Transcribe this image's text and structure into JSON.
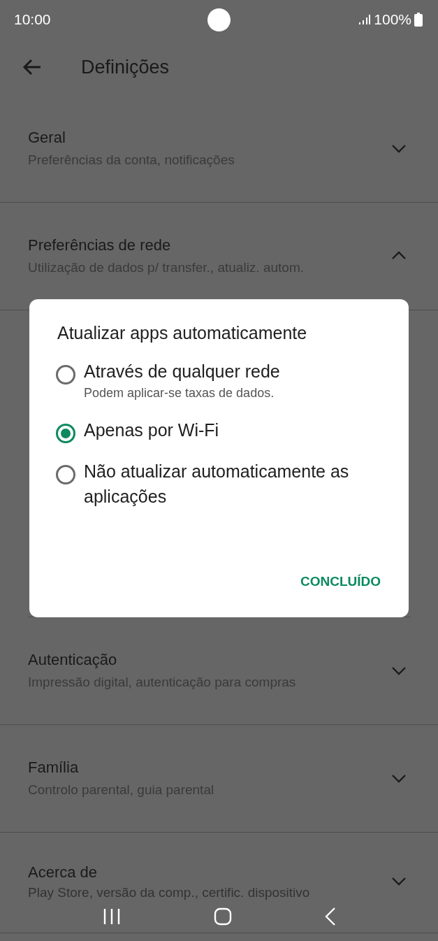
{
  "status_bar": {
    "time": "10:00",
    "battery": "100%"
  },
  "header": {
    "title": "Definições"
  },
  "sections": [
    {
      "title": "Geral",
      "subtitle": "Preferências da conta, notificações",
      "expanded": false
    },
    {
      "title": "Preferências de rede",
      "subtitle": "Utilização de dados p/ transfer., atualiz. autom.",
      "expanded": true
    },
    {
      "title": "Autenticação",
      "subtitle": "Impressão digital, autenticação para compras",
      "expanded": false
    },
    {
      "title": "Família",
      "subtitle": "Controlo parental, guia parental",
      "expanded": false
    },
    {
      "title": "Acerca de",
      "subtitle": "Play Store, versão da comp., certific. dispositivo",
      "expanded": false
    }
  ],
  "dialog": {
    "title": "Atualizar apps automaticamente",
    "options": [
      {
        "label": "Através de qualquer rede",
        "hint": "Podem aplicar-se taxas de dados.",
        "selected": false
      },
      {
        "label": "Apenas por Wi-Fi",
        "selected": true
      },
      {
        "label": "Não atualizar automaticamente as aplicações",
        "selected": false
      }
    ],
    "button": "CONCLUÍDO"
  }
}
